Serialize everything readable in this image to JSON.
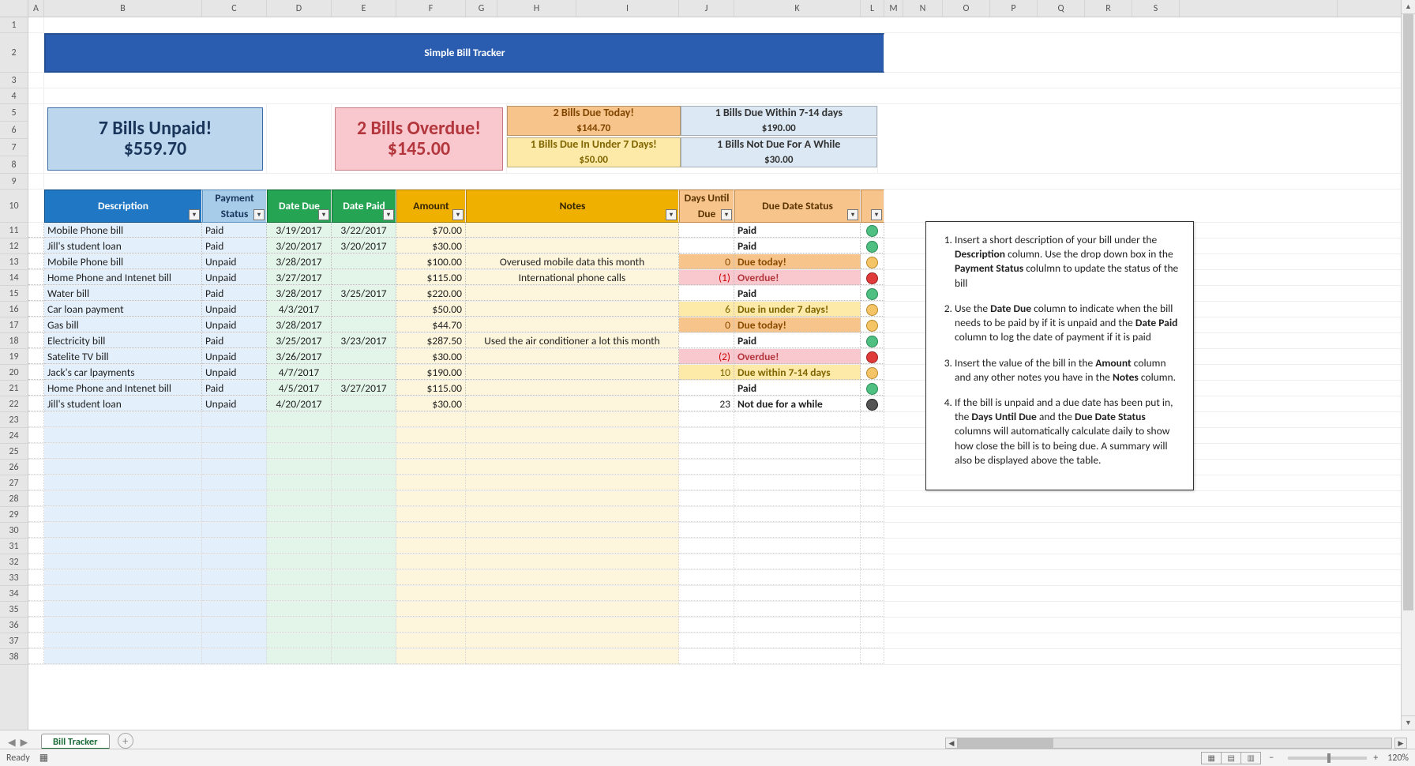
{
  "title": "Simple Bill Tracker",
  "columns_letters": [
    "A",
    "B",
    "C",
    "D",
    "E",
    "F",
    "G",
    "H",
    "I",
    "J",
    "K",
    "L",
    "M",
    "N",
    "O",
    "P",
    "Q",
    "R",
    "S"
  ],
  "row_numbers_prefix": [
    1,
    2,
    3,
    4,
    5,
    6,
    7,
    8,
    9,
    10
  ],
  "data_first_row": 11,
  "summary": {
    "unpaid_line1": "7 Bills Unpaid!",
    "unpaid_line2": "$559.70",
    "overdue_line1": "2 Bills Overdue!",
    "overdue_line2": "$145.00",
    "due_today_l1": "2 Bills Due Today!",
    "due_today_l2": "$144.70",
    "due_7_l1": "1 Bills Due In Under 7 Days!",
    "due_7_l2": "$50.00",
    "due_14_l1": "1 Bills Due Within 7-14 days",
    "due_14_l2": "$190.00",
    "due_far_l1": "1 Bills Not Due For A While",
    "due_far_l2": "$30.00"
  },
  "headers": {
    "desc": "Description",
    "status1": "Payment",
    "status2": "Status",
    "date_due": "Date Due",
    "date_paid": "Date Paid",
    "amount": "Amount",
    "notes": "Notes",
    "days1": "Days Until",
    "days2": "Due",
    "dds": "Due Date Status"
  },
  "rows": [
    {
      "desc": "Mobile Phone bill",
      "status": "Paid",
      "ddue": "3/19/2017",
      "dpaid": "3/22/2017",
      "amt": "$70.00",
      "notes": "",
      "days": "",
      "dlabel": "Paid",
      "dclass": "paid",
      "dot": "green"
    },
    {
      "desc": "Jill's student loan",
      "status": "Paid",
      "ddue": "3/20/2017",
      "dpaid": "3/20/2017",
      "amt": "$30.00",
      "notes": "",
      "days": "",
      "dlabel": "Paid",
      "dclass": "paid",
      "dot": "green"
    },
    {
      "desc": "Mobile Phone bill",
      "status": "Unpaid",
      "ddue": "3/28/2017",
      "dpaid": "",
      "amt": "$100.00",
      "notes": "Overused mobile data this month",
      "days": "0",
      "dlabel": "Due today!",
      "dclass": "today",
      "dot": "orange"
    },
    {
      "desc": "Home Phone and Intenet bill",
      "status": "Unpaid",
      "ddue": "3/27/2017",
      "dpaid": "",
      "amt": "$115.00",
      "notes": "International phone calls",
      "days": "(1)",
      "dlabel": "Overdue!",
      "dclass": "overdue",
      "dot": "red"
    },
    {
      "desc": "Water bill",
      "status": "Paid",
      "ddue": "3/28/2017",
      "dpaid": "3/25/2017",
      "amt": "$220.00",
      "notes": "",
      "days": "",
      "dlabel": "Paid",
      "dclass": "paid",
      "dot": "green"
    },
    {
      "desc": "Car loan payment",
      "status": "Unpaid",
      "ddue": "4/3/2017",
      "dpaid": "",
      "amt": "$50.00",
      "notes": "",
      "days": "6",
      "dlabel": "Due in under 7 days!",
      "dclass": "7",
      "dot": "orange"
    },
    {
      "desc": "Gas bill",
      "status": "Unpaid",
      "ddue": "3/28/2017",
      "dpaid": "",
      "amt": "$44.70",
      "notes": "",
      "days": "0",
      "dlabel": "Due today!",
      "dclass": "today",
      "dot": "orange"
    },
    {
      "desc": "Electricity bill",
      "status": "Paid",
      "ddue": "3/25/2017",
      "dpaid": "3/23/2017",
      "amt": "$287.50",
      "notes": "Used the air conditioner a lot this month",
      "days": "",
      "dlabel": "Paid",
      "dclass": "paid",
      "dot": "green"
    },
    {
      "desc": "Satelite TV bill",
      "status": "Unpaid",
      "ddue": "3/26/2017",
      "dpaid": "",
      "amt": "$30.00",
      "notes": "",
      "days": "(2)",
      "dlabel": "Overdue!",
      "dclass": "overdue",
      "dot": "red"
    },
    {
      "desc": "Jack's car lpayments",
      "status": "Unpaid",
      "ddue": "4/7/2017",
      "dpaid": "",
      "amt": "$190.00",
      "notes": "",
      "days": "10",
      "dlabel": "Due within 7-14 days",
      "dclass": "14",
      "dot": "orange"
    },
    {
      "desc": "Home Phone and Intenet bill",
      "status": "Paid",
      "ddue": "4/5/2017",
      "dpaid": "3/27/2017",
      "amt": "$115.00",
      "notes": "",
      "days": "",
      "dlabel": "Paid",
      "dclass": "paid",
      "dot": "green"
    },
    {
      "desc": "Jill's student loan",
      "status": "Unpaid",
      "ddue": "4/20/2017",
      "dpaid": "",
      "amt": "$30.00",
      "notes": "",
      "days": "23",
      "dlabel": "Not due for a while",
      "dclass": "far",
      "dot": "grey"
    }
  ],
  "empty_row_count": 16,
  "instructions": {
    "i1a": "Insert a short description of your bill  under the ",
    "i1b": "Description",
    "i1c": " column. Use the drop down box in the ",
    "i1d": "Payment Status",
    "i1e": " colulmn to update the status of the bill",
    "i2a": "Use the ",
    "i2b": "Date Due ",
    "i2c": " column to indicate when the bill needs to be paid by if it is unpaid and the ",
    "i2d": "Date Paid",
    "i2e": " column to log the date of payment if it is paid",
    "i3a": "Insert the value of the bill in the ",
    "i3b": "Amount",
    "i3c": " column and any other notes you have in the ",
    "i3d": "Notes",
    "i3e": " column.",
    "i4a": "If the bill is unpaid and a due date has been put in, the ",
    "i4b": "Days Until Due",
    "i4c": " and the ",
    "i4d": "Due Date Status",
    "i4e": " columns will automatically calculate daily to show how close the bill is to being due. A summary will also be displayed above the table."
  },
  "sheet_tab": "Bill Tracker",
  "status_ready": "Ready",
  "zoom_label": "120%"
}
